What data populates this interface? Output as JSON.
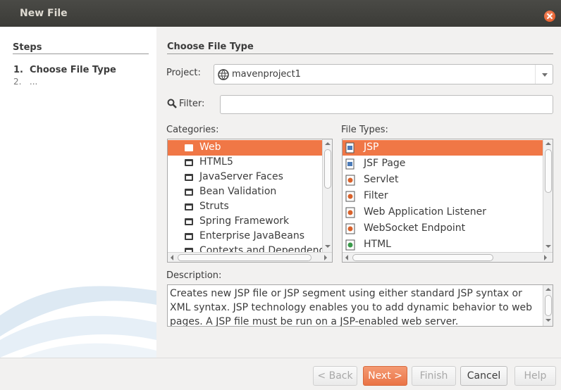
{
  "window": {
    "title": "New File"
  },
  "steps": {
    "heading": "Steps",
    "items": [
      {
        "number": "1.",
        "label": "Choose File Type"
      },
      {
        "number": "2.",
        "label": "..."
      }
    ]
  },
  "main": {
    "heading": "Choose File Type",
    "project": {
      "label": "Project:",
      "mnemonic": "P",
      "value": "mavenproject1"
    },
    "filter": {
      "label": "Filter:",
      "value": ""
    },
    "categories": {
      "label": "Categories:",
      "items": [
        "Web",
        "HTML5",
        "JavaServer Faces",
        "Bean Validation",
        "Struts",
        "Spring Framework",
        "Enterprise JavaBeans",
        "Contexts and Dependency"
      ],
      "selected": "Web"
    },
    "file_types": {
      "label": "File Types:",
      "items": [
        {
          "label": "JSP",
          "icon": "jsp-file-icon"
        },
        {
          "label": "JSF Page",
          "icon": "jsf-page-icon"
        },
        {
          "label": "Servlet",
          "icon": "java-class-icon"
        },
        {
          "label": "Filter",
          "icon": "java-class-icon"
        },
        {
          "label": "Web Application Listener",
          "icon": "java-class-icon"
        },
        {
          "label": "WebSocket Endpoint",
          "icon": "java-class-icon"
        },
        {
          "label": "HTML",
          "icon": "html-file-icon"
        }
      ],
      "selected": "JSP"
    },
    "description": {
      "label": "Description:",
      "text": "Creates new JSP file or JSP segment using either standard JSP syntax or XML syntax. JSP technology enables you to add dynamic behavior to web pages. A JSP file must be run on a JSP-enabled web server."
    }
  },
  "buttons": {
    "back": "< Back",
    "next": "Next >",
    "finish": "Finish",
    "cancel": "Cancel",
    "help": "Help"
  },
  "colors": {
    "accent": "#f07746",
    "titlebar": "#3c3b37",
    "close": "#e95420"
  }
}
